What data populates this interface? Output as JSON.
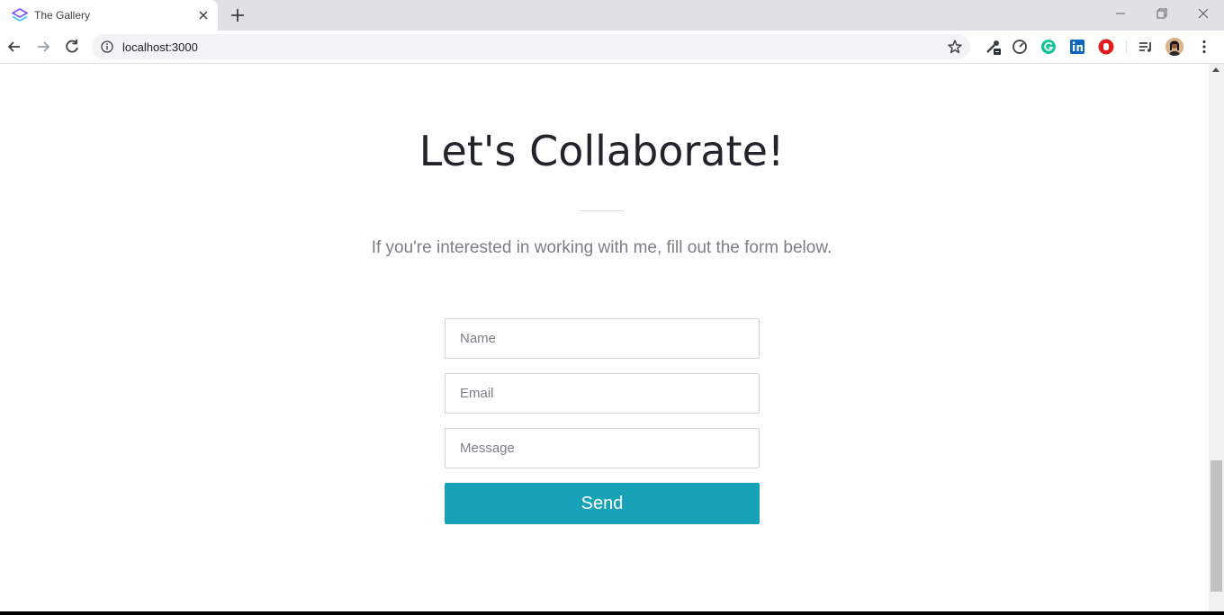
{
  "browser": {
    "tab_title": "The Gallery",
    "url": "localhost:3000"
  },
  "icons": {
    "favicon": "layers-icon",
    "tab_close": "close-icon",
    "new_tab": "plus-icon",
    "back": "arrow-left-icon",
    "forward": "arrow-right-icon",
    "reload": "reload-icon",
    "site_info": "info-icon",
    "bookmark": "star-icon",
    "extensions": [
      "eyedropper-icon",
      "speedometer-icon",
      "grammarly-icon",
      "linkedin-icon",
      "stop-hand-icon",
      "media-queue-icon",
      "avatar-icon",
      "kebab-menu-icon"
    ]
  },
  "colors": {
    "accent": "#17a2b8",
    "heading": "#212529",
    "subtitle": "#7a7f85"
  },
  "contact": {
    "heading": "Let's Collaborate!",
    "subtitle": "If you're interested in working with me, fill out the form below.",
    "name_placeholder": "Name",
    "email_placeholder": "Email",
    "message_placeholder": "Message",
    "send_label": "Send"
  }
}
